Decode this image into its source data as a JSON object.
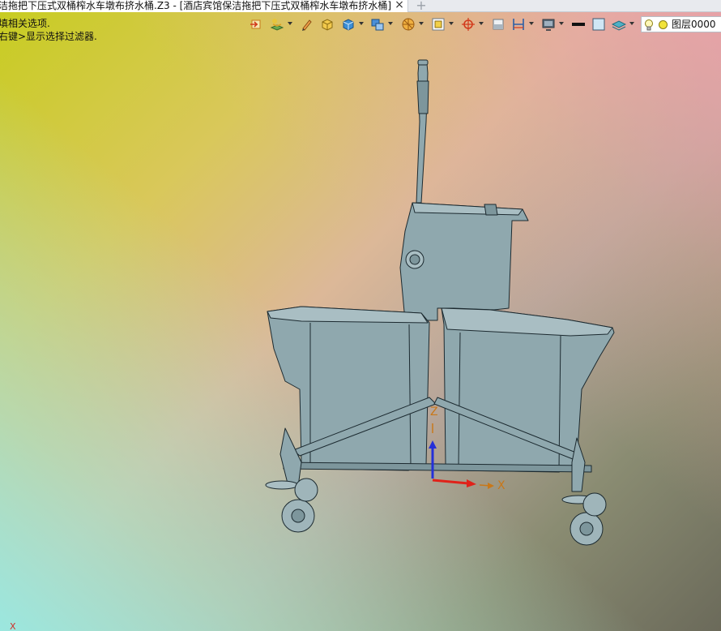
{
  "window": {
    "tab_title": "洁拖把下压式双桶榨水车墩布挤水桶.Z3 - [酒店宾馆保洁拖把下压式双桶榨水车墩布挤水桶]",
    "tab_close": "×",
    "tab_add": "+"
  },
  "prompts": {
    "line1": "填相关选项.",
    "line2": "右键>显示选择过滤器."
  },
  "toolbar": {
    "buttons": [
      {
        "icon": "exit-sketch-icon"
      },
      {
        "icon": "layer-manager-icon"
      },
      {
        "icon": "pencil-icon"
      },
      {
        "icon": "shaded-box-icon"
      },
      {
        "icon": "view-cube-icon"
      },
      {
        "icon": "display-mode-icon"
      },
      {
        "icon": "render-mode-icon"
      },
      {
        "icon": "view-fit-icon"
      },
      {
        "icon": "snap-target-icon"
      },
      {
        "icon": "section-view-icon"
      },
      {
        "icon": "dimension-icon"
      },
      {
        "icon": "monitor-icon"
      },
      {
        "icon": "line-width-icon"
      },
      {
        "icon": "color-fill-icon"
      },
      {
        "icon": "layer-visibility-icon"
      }
    ]
  },
  "layer": {
    "name": "图层0000",
    "bulb_icon": "lightbulb-icon",
    "color": "#f2e33a"
  },
  "axes": {
    "z_label": "Z",
    "x_label": "X",
    "corner_x_label": "X"
  },
  "colors": {
    "model_fill": "#8fa8ae",
    "model_stroke": "#1c2a30",
    "axis_z": "#2430d8",
    "axis_x": "#e0221a",
    "axis_label": "#c8781a"
  }
}
